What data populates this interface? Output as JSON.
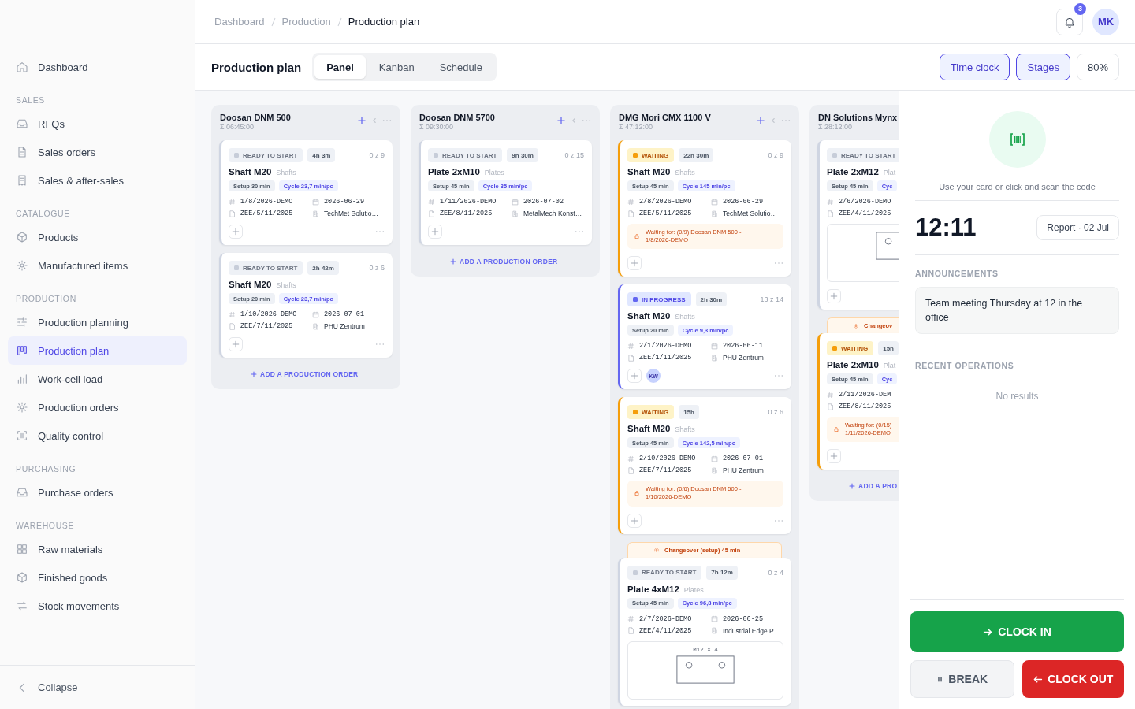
{
  "sidebar": {
    "top": [
      {
        "label": "Dashboard",
        "selected": false
      }
    ],
    "sections": [
      {
        "title": "SALES",
        "items": [
          {
            "label": "RFQs",
            "selected": false
          },
          {
            "label": "Sales orders",
            "selected": false
          },
          {
            "label": "Sales & after-sales",
            "selected": false
          }
        ]
      },
      {
        "title": "CATALOGUE",
        "items": [
          {
            "label": "Products",
            "selected": false
          },
          {
            "label": "Manufactured items",
            "selected": false
          }
        ]
      },
      {
        "title": "PRODUCTION",
        "items": [
          {
            "label": "Production planning",
            "selected": false
          },
          {
            "label": "Production plan",
            "selected": true
          },
          {
            "label": "Work-cell load",
            "selected": false
          },
          {
            "label": "Production orders",
            "selected": false
          },
          {
            "label": "Quality control",
            "selected": false
          }
        ]
      },
      {
        "title": "PURCHASING",
        "items": [
          {
            "label": "Purchase orders",
            "selected": false
          }
        ]
      },
      {
        "title": "WAREHOUSE",
        "items": [
          {
            "label": "Raw materials",
            "selected": false
          },
          {
            "label": "Finished goods",
            "selected": false
          },
          {
            "label": "Stock movements",
            "selected": false
          }
        ]
      }
    ],
    "collapse": "Collapse"
  },
  "breadcrumb": [
    "Dashboard",
    "Production",
    "Production plan"
  ],
  "notifications": {
    "count": "3"
  },
  "user": {
    "initials": "MK"
  },
  "toolbar": {
    "title": "Production plan",
    "tabs": [
      {
        "label": "Panel",
        "selected": true
      },
      {
        "label": "Kanban",
        "selected": false
      },
      {
        "label": "Schedule",
        "selected": false
      }
    ],
    "buttons": [
      {
        "label": "Time clock",
        "on": true
      },
      {
        "label": "Stages",
        "on": true
      },
      {
        "label": "80%",
        "on": false
      }
    ]
  },
  "board": {
    "columns": [
      {
        "name": "Doosan DNM 500",
        "total": "Σ 06:45:00",
        "actions": true,
        "add": "ADD A PRODUCTION ORDER",
        "items": [
          {
            "kind": "order",
            "status": {
              "kind": "ready",
              "label": "READY TO START"
            },
            "duration": "4h 3m",
            "count": "0 z 9",
            "title": "Shaft M20",
            "category": "Shafts",
            "setup": "Setup 30 min",
            "cycle": "Cycle 23,7 min/pc",
            "order": "1/8/2026-DEMO",
            "date": "2026-06-29",
            "document": "ZEE/5/11/2025",
            "customer": "TechMet Solutio…",
            "footer": true,
            "menu": true
          },
          {
            "kind": "order",
            "status": {
              "kind": "ready",
              "label": "READY TO START"
            },
            "duration": "2h 42m",
            "count": "0 z 6",
            "title": "Shaft M20",
            "category": "Shafts",
            "setup": "Setup 20 min",
            "cycle": "Cycle 23,7 min/pc",
            "order": "1/10/2026-DEMO",
            "date": "2026-07-01",
            "document": "ZEE/7/11/2025",
            "customer": "PHU Zentrum",
            "footer": true,
            "menu": true
          }
        ]
      },
      {
        "name": "Doosan DNM 5700",
        "total": "Σ 09:30:00",
        "actions": true,
        "add": "ADD A PRODUCTION ORDER",
        "items": [
          {
            "kind": "order",
            "status": {
              "kind": "ready",
              "label": "READY TO START"
            },
            "duration": "9h 30m",
            "count": "0 z 15",
            "title": "Plate 2xM10",
            "category": "Plates",
            "setup": "Setup 45 min",
            "cycle": "Cycle 35 min/pc",
            "order": "1/11/2026-DEMO",
            "date": "2026-07-02",
            "document": "ZEE/8/11/2025",
            "customer": "MetalMech Konst…",
            "footer": true,
            "menu": true
          }
        ]
      },
      {
        "name": "DMG Mori CMX 1100 V",
        "total": "Σ 47:12:00",
        "actions": true,
        "items": [
          {
            "kind": "order",
            "status": {
              "kind": "waiting",
              "label": "WAITING"
            },
            "duration": "22h 30m",
            "count": "0 z 9",
            "title": "Shaft M20",
            "category": "Shafts",
            "setup": "Setup 45 min",
            "cycle": "Cycle 145 min/pc",
            "order": "2/8/2026-DEMO",
            "date": "2026-06-29",
            "document": "ZEE/5/11/2025",
            "customer": "TechMet Solutio…",
            "note": [
              "Waiting for: (0/9) Doosan DNM 500 -",
              "1/8/2026-DEMO"
            ],
            "footer": true,
            "menu": true
          },
          {
            "kind": "order",
            "status": {
              "kind": "in_progress",
              "label": "IN PROGRESS"
            },
            "duration": "2h 30m",
            "count": "13 z 14",
            "title": "Shaft M20",
            "category": "Shafts",
            "setup": "Setup 20 min",
            "cycle": "Cycle 9,3 min/pc",
            "order": "2/1/2026-DEMO",
            "date": "2026-06-11",
            "document": "ZEE/1/11/2025",
            "customer": "PHU Zentrum",
            "assignees": [
              "KW"
            ],
            "footer": true,
            "menu": true
          },
          {
            "kind": "order",
            "status": {
              "kind": "waiting",
              "label": "WAITING"
            },
            "duration": "15h",
            "count": "0 z 6",
            "title": "Shaft M20",
            "category": "Shafts",
            "setup": "Setup 45 min",
            "cycle": "Cycle 142,5 min/pc",
            "order": "2/10/2026-DEMO",
            "date": "2026-07-01",
            "document": "ZEE/7/11/2025",
            "customer": "PHU Zentrum",
            "note": [
              "Waiting for: (0/6) Doosan DNM 500 -",
              "1/10/2026-DEMO"
            ],
            "footer": true,
            "menu": true
          },
          {
            "kind": "changeover",
            "text": "Changeover (setup) 45 min"
          },
          {
            "kind": "order",
            "status": {
              "kind": "ready",
              "label": "READY TO START"
            },
            "duration": "7h 12m",
            "count": "0 z 4",
            "title": "Plate 4xM12",
            "category": "Plates",
            "setup": "Setup 45 min",
            "cycle": "Cycle 96,8 min/pc",
            "order": "2/7/2026-DEMO",
            "date": "2026-06-25",
            "document": "ZEE/4/11/2025",
            "customer": "Industrial Edge P…",
            "drawing": {
              "kind": "plate",
              "label": "M12 × 4"
            },
            "footer": false
          }
        ]
      },
      {
        "name": "DN Solutions Mynx",
        "total": "Σ 28:12:00",
        "actions": false,
        "add": "ADD A PRO",
        "items": [
          {
            "kind": "order",
            "status": {
              "kind": "ready",
              "label": "READY TO START"
            },
            "title": "Plate 2xM12",
            "category": "Plat",
            "setup": "Setup 45 min",
            "cycle": "Cyc",
            "order": "2/6/2026-DEMO",
            "document": "ZEE/4/11/2025",
            "drawing": {
              "kind": "plate"
            },
            "footer": true
          },
          {
            "kind": "changeover",
            "text": "Changeov"
          },
          {
            "kind": "order",
            "status": {
              "kind": "waiting",
              "label": "WAITING"
            },
            "duration": "15h",
            "title": "Plate 2xM10",
            "category": "Plat",
            "setup": "Setup 45 min",
            "cycle": "Cyc",
            "order": "2/11/2026-DEM",
            "document": "ZEE/8/11/2025",
            "note": [
              "Waiting for: (0/15)",
              "1/11/2026-DEMO"
            ],
            "footer": true
          }
        ]
      }
    ]
  },
  "panel": {
    "scan_hint": "Use your card or click and scan the code",
    "time": "12:11",
    "report": "Report · 02 Jul",
    "announcements": {
      "title": "ANNOUNCEMENTS",
      "items": [
        "Team meeting Thursday at 12 in the office"
      ]
    },
    "recent": {
      "title": "RECENT OPERATIONS",
      "empty": "No results"
    },
    "clock_in": "CLOCK IN",
    "break": "BREAK",
    "clock_out": "CLOCK OUT"
  }
}
